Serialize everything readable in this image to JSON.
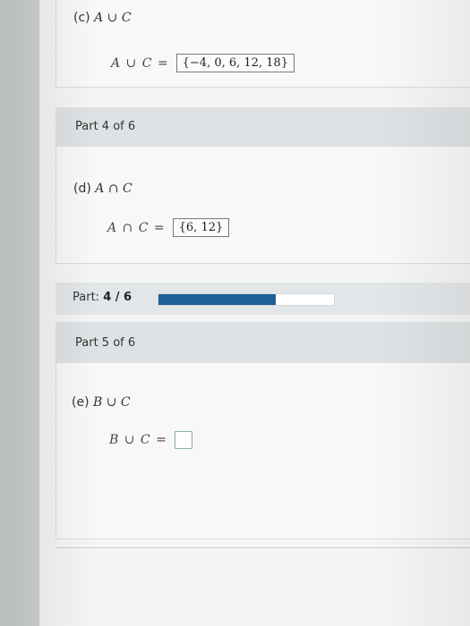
{
  "part_c": {
    "label_prefix": "(c) ",
    "label_math": "A ∪ C",
    "equation_lhs": "A ∪ C =",
    "answer": "{−4, 0, 6, 12, 18}"
  },
  "part_4_header": "Part 4 of 6",
  "part_d": {
    "label_prefix": "(d) ",
    "label_math": "A ∩ C",
    "equation_lhs": "A ∩ C =",
    "answer": "{6, 12}"
  },
  "progress": {
    "label": "Part:",
    "value_text": "4 / 6",
    "fraction": 0.6667,
    "fill_color": "#1f5e98"
  },
  "part_5_header": "Part 5 of 6",
  "part_e": {
    "label_prefix": "(e) ",
    "label_math": "B ∪ C",
    "equation_lhs": "B ∪ C =",
    "answer": ""
  }
}
